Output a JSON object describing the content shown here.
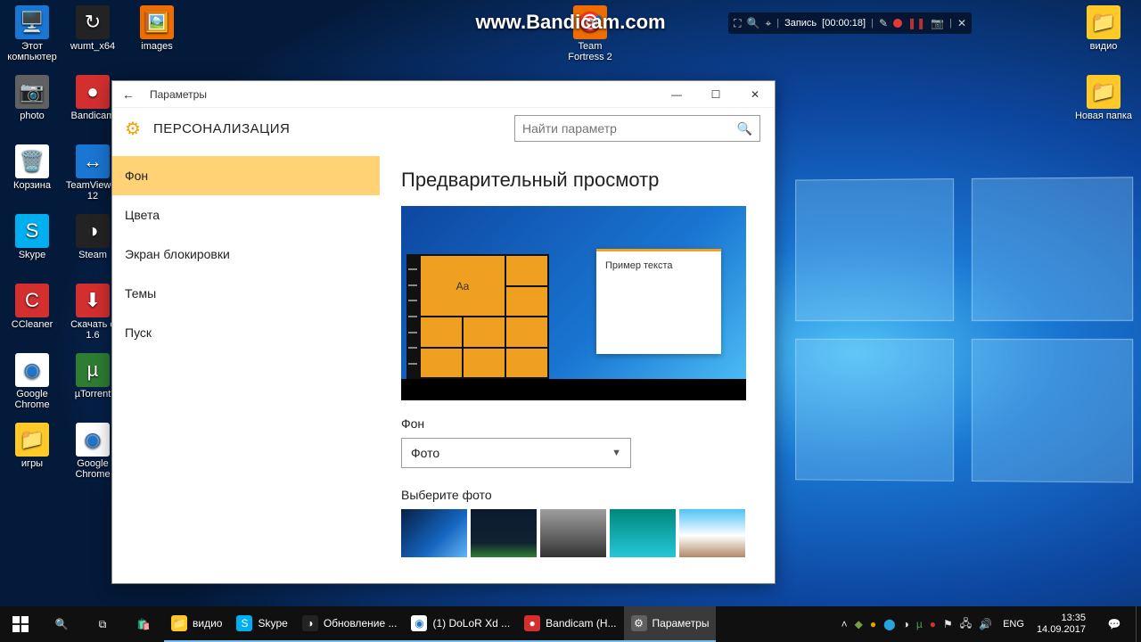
{
  "watermark": {
    "url": "www.Bandicam.com"
  },
  "bandicam_bar": {
    "status_label": "Запись",
    "timer": "[00:00:18]"
  },
  "desktop": {
    "col1": [
      {
        "label": "Этот компьютер",
        "icon": "🖥️"
      },
      {
        "label": "photo",
        "icon": "📷"
      },
      {
        "label": "Корзина",
        "icon": "🗑️"
      },
      {
        "label": "Skype",
        "icon": "S"
      },
      {
        "label": "CCleaner",
        "icon": "C"
      },
      {
        "label": "Google Chrome",
        "icon": "◉"
      },
      {
        "label": "игры",
        "icon": "📁"
      }
    ],
    "col2": [
      {
        "label": "wumt_x64",
        "icon": "↻"
      },
      {
        "label": "Bandicam",
        "icon": "●"
      },
      {
        "label": "TeamViewer 12",
        "icon": "↔"
      },
      {
        "label": "Steam",
        "icon": "◑"
      },
      {
        "label": "Скачать c 1.6",
        "icon": "⬇"
      },
      {
        "label": "µTorrent",
        "icon": "µ"
      },
      {
        "label": "Google Chrome",
        "icon": "◉"
      }
    ],
    "col3": [
      {
        "label": "images",
        "icon": "🖼️"
      }
    ],
    "center": [
      {
        "label": "Team Fortress 2",
        "icon": "🎯"
      }
    ],
    "right": [
      {
        "label": "видио",
        "icon": "📁"
      },
      {
        "label": "Новая папка",
        "icon": "📁"
      }
    ]
  },
  "window": {
    "title": "Параметры",
    "header": "ПЕРСОНАЛИЗАЦИЯ",
    "search_placeholder": "Найти параметр",
    "sidebar": {
      "items": [
        {
          "label": "Фон",
          "active": true
        },
        {
          "label": "Цвета"
        },
        {
          "label": "Экран блокировки"
        },
        {
          "label": "Темы"
        },
        {
          "label": "Пуск"
        }
      ]
    },
    "content": {
      "preview_heading": "Предварительный просмотр",
      "preview_tile_text": "Aa",
      "preview_note_text": "Пример текста",
      "bg_label": "Фон",
      "bg_combo_value": "Фото",
      "choose_label": "Выберите фото"
    }
  },
  "taskbar": {
    "tasks": [
      {
        "label": "видио",
        "icon": "📁",
        "cls": "bg-folder"
      },
      {
        "label": "Skype",
        "icon": "S",
        "cls": "bg-sky"
      },
      {
        "label": "Обновление ...",
        "icon": "◑",
        "cls": "bg-dark"
      },
      {
        "label": "(1) DoLoR Xd ...",
        "icon": "◉",
        "cls": "bg-white"
      },
      {
        "label": "Bandicam (H...",
        "icon": "●",
        "cls": "bg-red"
      },
      {
        "label": "Параметры",
        "icon": "⚙",
        "cls": "bg-grey",
        "active": true
      }
    ],
    "lang": "ENG",
    "time": "13:35",
    "date": "14.09.2017"
  }
}
